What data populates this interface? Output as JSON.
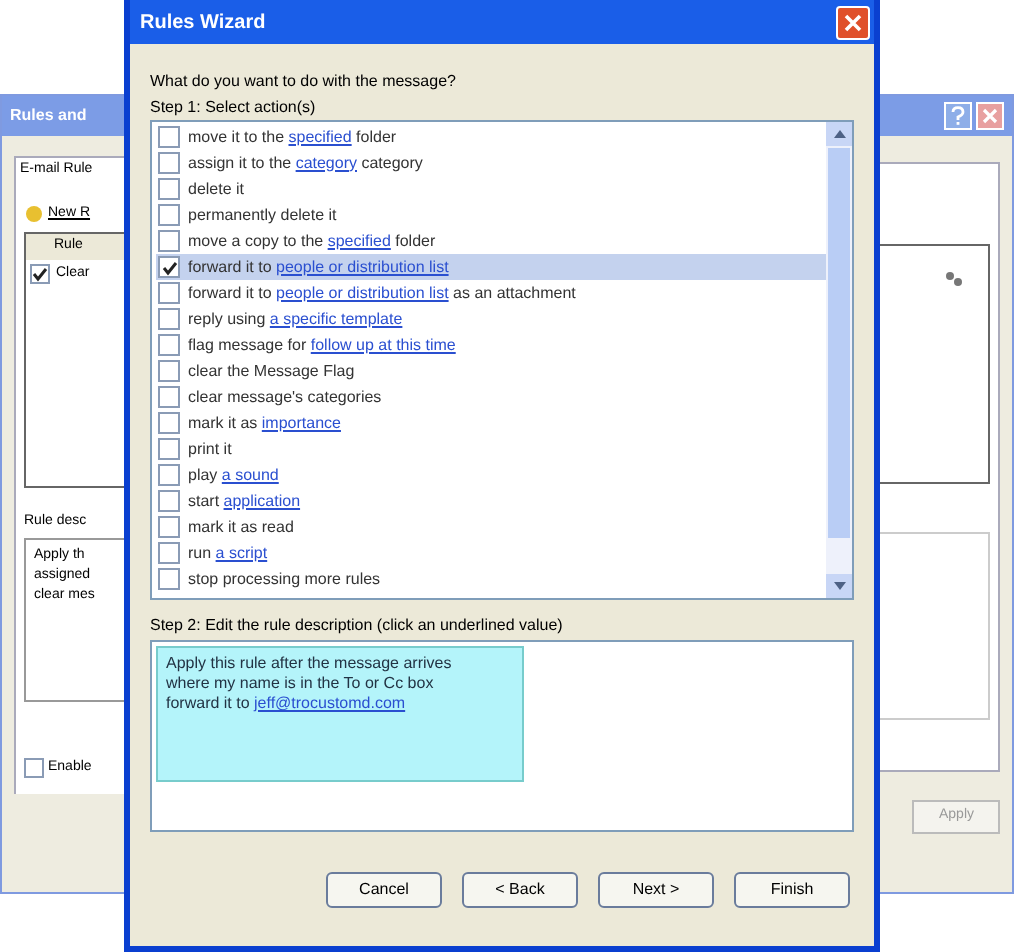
{
  "background_window": {
    "title": "Rules and",
    "tab": "E-mail Rule",
    "new_button": "New R",
    "list_header": "Rule",
    "rules": [
      {
        "name": "Clear",
        "checked": true
      }
    ],
    "description_label": "Rule desc",
    "description_lines": [
      "Apply th",
      "assigned",
      "clear mes"
    ],
    "enable_checkbox": {
      "label": "Enable",
      "checked": false
    },
    "apply_button": "Apply"
  },
  "wizard": {
    "title": "Rules Wizard",
    "question": "What do you want to do with the message?",
    "step1": "Step 1: Select action(s)",
    "actions": [
      {
        "checked": false,
        "selected": false,
        "parts": [
          {
            "text": "move it to the "
          },
          {
            "text": "specified",
            "link": true
          },
          {
            "text": " folder"
          }
        ]
      },
      {
        "checked": false,
        "selected": false,
        "parts": [
          {
            "text": "assign it to the "
          },
          {
            "text": "category",
            "link": true
          },
          {
            "text": " category"
          }
        ]
      },
      {
        "checked": false,
        "selected": false,
        "parts": [
          {
            "text": "delete it"
          }
        ]
      },
      {
        "checked": false,
        "selected": false,
        "parts": [
          {
            "text": "permanently delete it"
          }
        ]
      },
      {
        "checked": false,
        "selected": false,
        "parts": [
          {
            "text": "move a copy to the "
          },
          {
            "text": "specified",
            "link": true
          },
          {
            "text": " folder"
          }
        ]
      },
      {
        "checked": true,
        "selected": true,
        "parts": [
          {
            "text": "forward it to "
          },
          {
            "text": "people or distribution list",
            "link": true
          }
        ]
      },
      {
        "checked": false,
        "selected": false,
        "parts": [
          {
            "text": "forward it to "
          },
          {
            "text": "people or distribution list",
            "link": true
          },
          {
            "text": " as an attachment"
          }
        ]
      },
      {
        "checked": false,
        "selected": false,
        "parts": [
          {
            "text": "reply using "
          },
          {
            "text": "a specific template",
            "link": true
          }
        ]
      },
      {
        "checked": false,
        "selected": false,
        "parts": [
          {
            "text": "flag message for "
          },
          {
            "text": "follow up at this time",
            "link": true
          }
        ]
      },
      {
        "checked": false,
        "selected": false,
        "parts": [
          {
            "text": "clear the Message Flag"
          }
        ]
      },
      {
        "checked": false,
        "selected": false,
        "parts": [
          {
            "text": "clear message's categories"
          }
        ]
      },
      {
        "checked": false,
        "selected": false,
        "parts": [
          {
            "text": "mark it as "
          },
          {
            "text": "importance",
            "link": true
          }
        ]
      },
      {
        "checked": false,
        "selected": false,
        "parts": [
          {
            "text": "print it"
          }
        ]
      },
      {
        "checked": false,
        "selected": false,
        "parts": [
          {
            "text": "play "
          },
          {
            "text": "a sound",
            "link": true
          }
        ]
      },
      {
        "checked": false,
        "selected": false,
        "parts": [
          {
            "text": "start "
          },
          {
            "text": "application",
            "link": true
          }
        ]
      },
      {
        "checked": false,
        "selected": false,
        "parts": [
          {
            "text": "mark it as read"
          }
        ]
      },
      {
        "checked": false,
        "selected": false,
        "parts": [
          {
            "text": "run "
          },
          {
            "text": "a script",
            "link": true
          }
        ]
      },
      {
        "checked": false,
        "selected": false,
        "parts": [
          {
            "text": "stop processing more rules"
          }
        ]
      }
    ],
    "step2": "Step 2: Edit the rule description (click an underlined value)",
    "description": [
      [
        {
          "text": "Apply this rule after the message arrives"
        }
      ],
      [
        {
          "text": "where my name is in the To or Cc box"
        }
      ],
      [
        {
          "text": "forward it to "
        },
        {
          "text": "jeff@trocustomd.com",
          "link": true
        }
      ]
    ],
    "buttons": [
      "Cancel",
      "< Back",
      "Next >",
      "Finish"
    ]
  }
}
